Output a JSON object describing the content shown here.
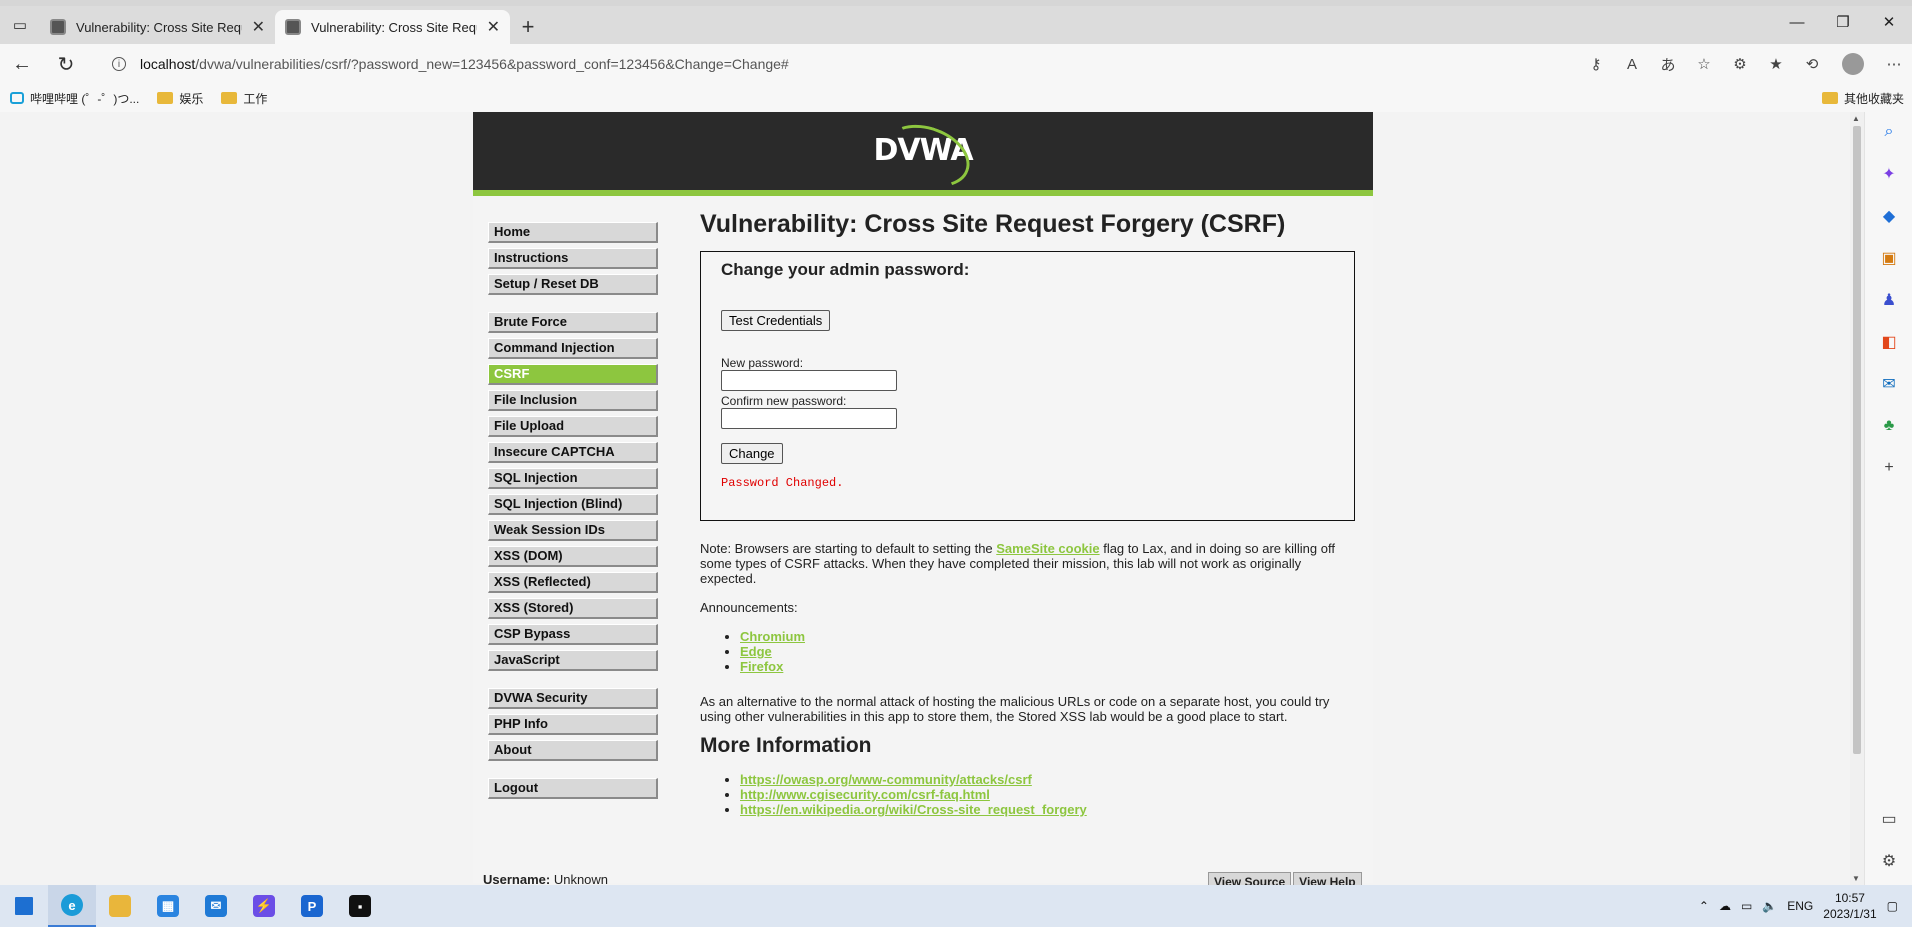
{
  "browser": {
    "tabs": [
      {
        "title": "Vulnerability: Cross Site Request"
      },
      {
        "title": "Vulnerability: Cross Site Request"
      }
    ],
    "url_host": "localhost",
    "url_path": "/dvwa/vulnerabilities/csrf/?password_new=123456&password_conf=123456&Change=Change#",
    "bookmarks": [
      {
        "label": "哔哩哔哩 (゜-゜)つ...",
        "icon": "bilibili-icon"
      },
      {
        "label": "娱乐",
        "icon": "folder-icon"
      },
      {
        "label": "工作",
        "icon": "folder-icon"
      }
    ],
    "other_bookmarks": "其他收藏夹"
  },
  "dvwa": {
    "logo": "DVWA",
    "menu": {
      "group1": [
        "Home",
        "Instructions",
        "Setup / Reset DB"
      ],
      "group2": [
        "Brute Force",
        "Command Injection",
        "CSRF",
        "File Inclusion",
        "File Upload",
        "Insecure CAPTCHA",
        "SQL Injection",
        "SQL Injection (Blind)",
        "Weak Session IDs",
        "XSS (DOM)",
        "XSS (Reflected)",
        "XSS (Stored)",
        "CSP Bypass",
        "JavaScript"
      ],
      "group3": [
        "DVWA Security",
        "PHP Info",
        "About"
      ],
      "group4": [
        "Logout"
      ],
      "selected": "CSRF"
    },
    "page_title": "Vulnerability: Cross Site Request Forgery (CSRF)",
    "form": {
      "heading": "Change your admin password:",
      "test_button": "Test Credentials",
      "new_password_label": "New password:",
      "confirm_password_label": "Confirm new password:",
      "new_password_value": "",
      "confirm_password_value": "",
      "change_button": "Change",
      "message": "Password Changed."
    },
    "note_before": "Note: Browsers are starting to default to setting the ",
    "note_link": "SameSite cookie",
    "note_after": " flag to Lax, and in doing so are killing off some types of CSRF attacks. When they have completed their mission, this lab will not work as originally expected.",
    "announcements_label": "Announcements:",
    "announcements": [
      "Chromium",
      "Edge",
      "Firefox"
    ],
    "alternative": "As an alternative to the normal attack of hosting the malicious URLs or code on a separate host, you could try using other vulnerabilities in this app to store them, the Stored XSS lab would be a good place to start.",
    "more_info_title": "More Information",
    "more_links": [
      "https://owasp.org/www-community/attacks/csrf",
      "http://www.cgisecurity.com/csrf-faq.html",
      "https://en.wikipedia.org/wiki/Cross-site_request_forgery"
    ],
    "footer_username_label": "Username:",
    "footer_username_value": "Unknown",
    "footer_buttons": [
      "View Source",
      "View Help"
    ]
  },
  "taskbar": {
    "lang": "ENG",
    "time": "10:57",
    "date": "2023/1/31"
  },
  "colors": {
    "accent_green": "#8dc63f",
    "header_dark": "#2a2a2a",
    "error_red": "#e00000"
  }
}
